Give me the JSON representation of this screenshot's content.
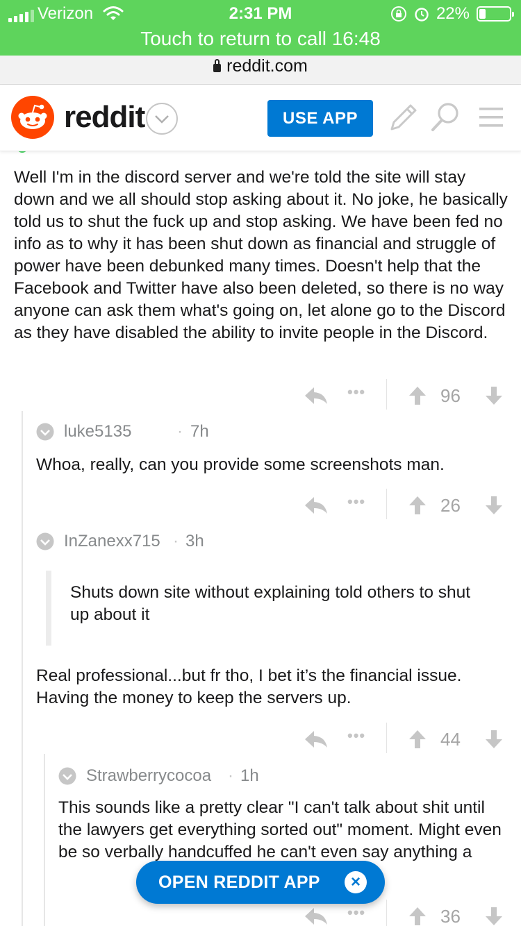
{
  "status_bar": {
    "carrier": "Verizon",
    "time": "2:31 PM",
    "battery_percent": "22%",
    "battery_level": 0.22,
    "call_banner": "Touch to return to call 16:48",
    "color": "#5ed45c"
  },
  "browser": {
    "url": "reddit.com"
  },
  "header": {
    "wordmark": "reddit",
    "use_app_label": "USE APP",
    "accent": "#0079d3",
    "logo_color": "#ff4500",
    "icons": [
      "pencil-icon",
      "search-icon",
      "menu-icon"
    ]
  },
  "comments": [
    {
      "text": "Well I'm in the discord server and we're told the site will stay down and we all should stop asking about it. No joke, he basically told us to shut the fuck up and stop asking. We have been fed no info as to why it has been shut down as financial and struggle of power have been debunked many times. Doesn't help that the Facebook and Twitter have also been deleted, so there is no way anyone can ask them what's going on, let alone go to the Discord as they have disabled the ability to invite people in the Discord.",
      "more": "•••",
      "score": "96"
    },
    {
      "author": "luke5135",
      "separator": "·",
      "age": "7h",
      "text": "Whoa, really, can you provide some screenshots man.",
      "more": "•••",
      "score": "26"
    },
    {
      "author": "InZanexx715",
      "separator": "·",
      "age": "3h",
      "quote": "Shuts down site without explaining told others to shut up about it",
      "text": "Real professional...but fr tho, I bet it’s the financial issue. Having the money to keep the servers up.",
      "more": "•••",
      "score": "44"
    },
    {
      "author": "Strawberrycocoa",
      "separator": "·",
      "age": "1h",
      "text": "This sounds like a pretty clear \"I can't talk about shit until the lawyers get everything sorted out\" moment. Might even be so verbally handcuffed he can't even say anything a",
      "more": "•••",
      "score": "36"
    }
  ],
  "floating_button": {
    "label": "OPEN REDDIT APP",
    "close": "×"
  }
}
